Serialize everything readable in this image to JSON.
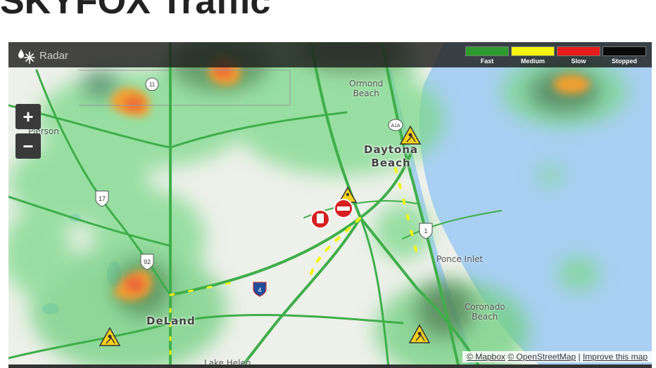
{
  "page": {
    "title": "SKYFOX Traffic"
  },
  "colors": {
    "fast": "#2e9b2e",
    "medium": "#f4f411",
    "slow": "#e81c1c",
    "stopped": "#0a0a0a",
    "water": "#a9cff2",
    "land": "#eef0ea"
  },
  "radar": {
    "label": "Radar",
    "icon": "snow-rain-icon"
  },
  "legend": [
    {
      "label": "Fast",
      "color": "#2e9b2e"
    },
    {
      "label": "Medium",
      "color": "#f4f411"
    },
    {
      "label": "Slow",
      "color": "#e81c1c"
    },
    {
      "label": "Stopped",
      "color": "#0a0a0a"
    }
  ],
  "zoom": {
    "in": "+",
    "out": "−"
  },
  "places": {
    "ormond": "Ormond Beach",
    "ormond_l1": "Ormond",
    "ormond_l2": "Beach",
    "daytona_l1": "Daytona",
    "daytona_l2": "Beach",
    "pierson": "Pierson",
    "ponce": "Ponce Inlet",
    "coronado_l1": "Coronado",
    "coronado_l2": "Beach",
    "deland": "DeLand",
    "lakehelen": "Lake Helen"
  },
  "shields": {
    "us17": "17",
    "us92": "92",
    "us1": "1",
    "i4": "4",
    "a1a": "A1A",
    "sr11": "11"
  },
  "attribution": {
    "mapbox": "© Mapbox",
    "osm": "© OpenStreetMap",
    "sep": "|",
    "improve": "Improve this map"
  }
}
